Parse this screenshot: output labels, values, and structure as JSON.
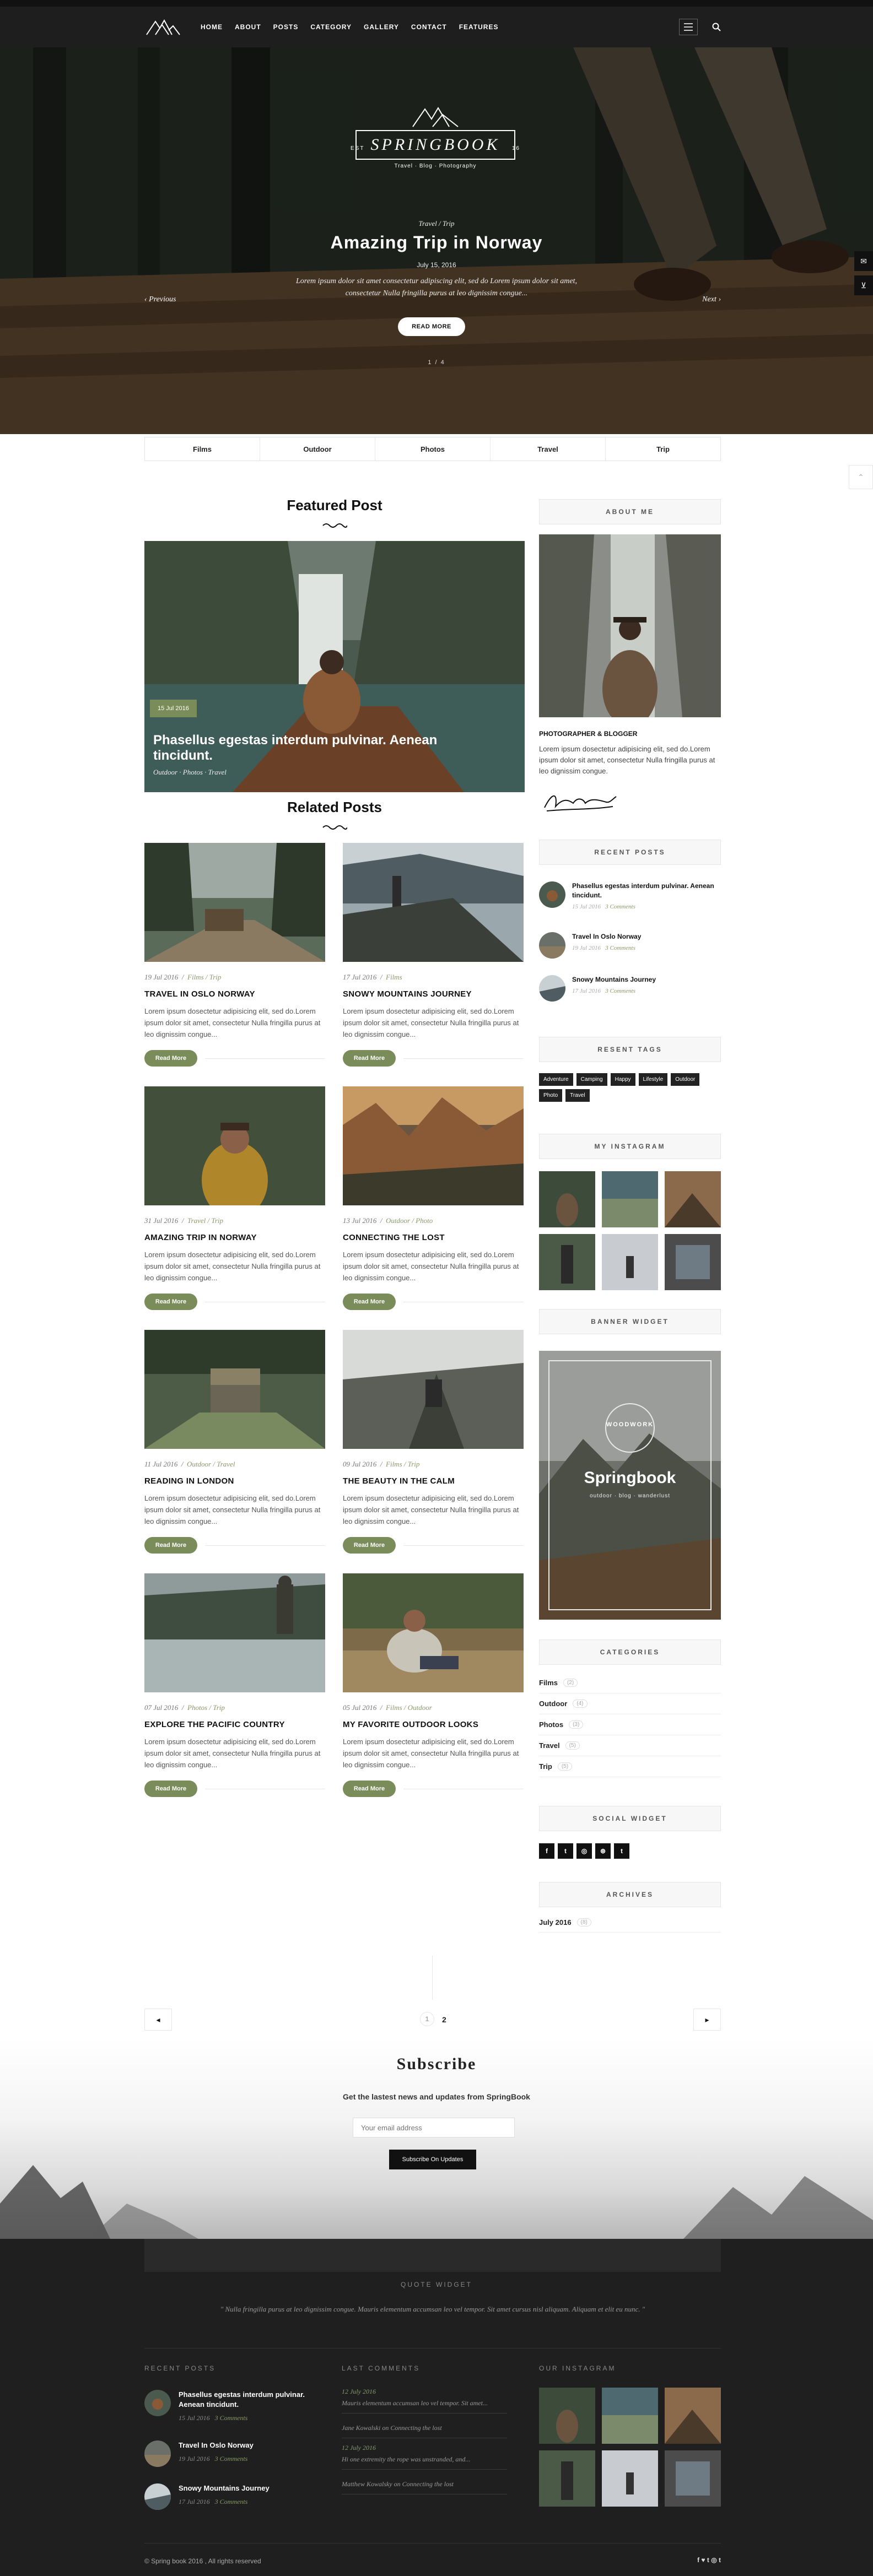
{
  "nav": {
    "menu": [
      "HOME",
      "ABOUT",
      "POSTS",
      "CATEGORY",
      "GALLERY",
      "CONTACT",
      "FEATURES"
    ]
  },
  "hero": {
    "est": "EST",
    "year": "16",
    "brand": "SPRINGBOOK",
    "tagline": "Travel · Blog · Photography",
    "cats": "Travel  / Trip",
    "title": "Amazing Trip in Norway",
    "date": "July 15, 2016",
    "text": "Lorem ipsum dolor sit amet consectetur adipiscing elit, sed do Lorem ipsum dolor sit amet, consectetur Nulla fringilla purus at leo dignissim congue...",
    "prev": "Previous",
    "next": "Next",
    "button": "READ MORE",
    "counter": "1 / 4"
  },
  "catstrip": [
    "Films",
    "Outdoor",
    "Photos",
    "Travel",
    "Trip"
  ],
  "featured": {
    "heading": "Featured Post",
    "date": "15 Jul 2016",
    "title": "Phasellus egestas interdum pulvinar. Aenean tincidunt.",
    "cats": "Outdoor  ·  Photos  ·  Travel"
  },
  "related": {
    "heading": "Related Posts",
    "excerpt": "Lorem ipsum dosectetur adipisicing elit, sed do.Lorem ipsum dolor sit amet, consectetur Nulla fringilla purus at leo dignissim congue...",
    "read_more": "Read More",
    "cards": [
      {
        "date": "19 Jul 2016",
        "cats": "Films / Trip",
        "title": "TRAVEL IN OSLO NORWAY"
      },
      {
        "date": "17 Jul 2016",
        "cats": "Films",
        "title": "SNOWY MOUNTAINS JOURNEY"
      },
      {
        "date": "31 Jul 2016",
        "cats": "Travel / Trip",
        "title": "AMAZING TRIP IN NORWAY"
      },
      {
        "date": "13 Jul 2016",
        "cats": "Outdoor / Photo",
        "title": "CONNECTING THE LOST"
      },
      {
        "date": "11 Jul 2016",
        "cats": "Outdoor / Travel",
        "title": "READING IN LONDON"
      },
      {
        "date": "09 Jul 2016",
        "cats": "Films / Trip",
        "title": "THE BEAUTY IN THE CALM"
      },
      {
        "date": "07 Jul 2016",
        "cats": "Photos / Trip",
        "title": "EXPLORE THE PACIFIC COUNTRY"
      },
      {
        "date": "05 Jul 2016",
        "cats": "Films / Outdoor",
        "title": "MY FAVORITE OUTDOOR LOOKS"
      }
    ]
  },
  "sidebar": {
    "about_head": "ABOUT ME",
    "role": "PHOTOGRAPHER & BLOGGER",
    "about_text": "Lorem ipsum dosectetur adipisicing elit, sed do.Lorem ipsum dolor sit amet, consectetur Nulla fringilla purus at leo dignissim congue.",
    "recent_head": "RECENT POSTS",
    "recent": [
      {
        "title": "Phasellus egestas interdum pulvinar. Aenean tincidunt.",
        "date": "15 Jul 2016",
        "comments": "3 Comments"
      },
      {
        "title": "Travel In Oslo Norway",
        "date": "19 Jul 2016",
        "comments": "3 Comments"
      },
      {
        "title": "Snowy Mountains Journey",
        "date": "17 Jul 2016",
        "comments": "3 Comments"
      }
    ],
    "tags_head": "RESENT TAGS",
    "tags": [
      "Adventure",
      "Camping",
      "Happy",
      "Lifestyle",
      "Outdoor",
      "Photo",
      "Travel"
    ],
    "insta_head": "MY INSTAGRAM",
    "banner_head": "BANNER WIDGET",
    "banner_title": "Springbook",
    "banner_sub": "outdoor · blog · wanderlust",
    "banner_badge": "WOODWORK",
    "cat_head": "CATEGORIES",
    "categories": [
      {
        "name": "Films",
        "count": "(2)"
      },
      {
        "name": "Outdoor",
        "count": "(4)"
      },
      {
        "name": "Photos",
        "count": "(3)"
      },
      {
        "name": "Travel",
        "count": "(5)"
      },
      {
        "name": "Trip",
        "count": "(5)"
      }
    ],
    "social_head": "SOCIAL WIDGET",
    "social": [
      "f",
      "t",
      "◎",
      "⊛",
      "t"
    ],
    "archives_head": "ARCHIVES",
    "archive": "July 2016",
    "archive_count": "(8)"
  },
  "pager": {
    "p1": "1",
    "p2": "2",
    "prev": "◂",
    "next": "▸"
  },
  "subscribe": {
    "title": "Subscribe",
    "text": "Get the lastest news and updates from SpringBook",
    "placeholder": "Your email address",
    "button": "Subscribe On Updates"
  },
  "footer": {
    "quote_head": "QUOTE WIDGET",
    "quote": "\" Nulla fringilla purus at leo dignissim congue. Mauris elementum accumsan leo vel tempor. Sit amet cursus nisl aliquam. Aliquam et elit eu nunc. \"",
    "recent_head": "RECENT POSTS",
    "comments_head": "LAST COMMENTS",
    "insta_head": "OUR INSTAGRAM",
    "recent": [
      {
        "title": "Phasellus egestas interdum pulvinar. Aenean tincidunt.",
        "date": "15 Jul 2016",
        "comments": "3 Comments"
      },
      {
        "title": "Travel In Oslo Norway",
        "date": "19 Jul 2016",
        "comments": "3 Comments"
      },
      {
        "title": "Snowy Mountains Journey",
        "date": "17 Jul 2016",
        "comments": "3 Comments"
      }
    ],
    "comments": [
      {
        "date": "12 July 2016",
        "text": "Mauris elementum accumsan leo vel tempor. Sit amet..."
      },
      {
        "date": "",
        "text": "Jane Kowalski on Connecting the lost"
      },
      {
        "date": "12 July 2016",
        "text": "Hi one extremity the rope was unstranded, and..."
      },
      {
        "date": "",
        "text": "Matthew Kowalsky on Connecting the lost"
      }
    ],
    "copyright": "© Spring book 2016 , All rights reserved",
    "social": "f ♥ t ◎ t"
  },
  "colors": {
    "accent": "#7a8c5a",
    "dark": "#1f1f1f"
  }
}
